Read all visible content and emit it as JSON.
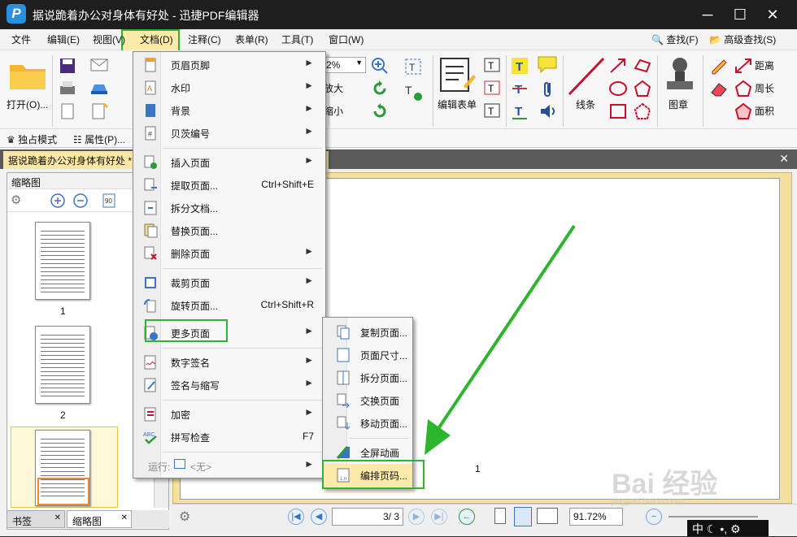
{
  "window": {
    "title": "据说跪着办公对身体有好处 - 迅捷PDF编辑器",
    "logo": "P"
  },
  "menus": [
    "文件",
    "编辑(E)",
    "视图(V)",
    "文档(D)",
    "注释(C)",
    "表单(R)",
    "工具(T)",
    "窗口(W)"
  ],
  "menu_right": {
    "find": "查找(F)",
    "adv_find": "高级查找(S)"
  },
  "ribbon": {
    "open": "打开(O)...",
    "zoom": "2%",
    "zoom_in_label": "放大",
    "zoom_out_label": "缩小",
    "edit_form": "编辑表单",
    "line": "线条",
    "stamp": "图章",
    "distance": "距离",
    "perimeter": "周长",
    "area": "面积",
    "exclusive": "独占模式",
    "properties": "属性(P)..."
  },
  "doc_tab": "据说跪着办公对身体有好处 *",
  "left_panel": {
    "header": "缩略图",
    "thumbs": [
      "1",
      "2"
    ],
    "tabs": [
      "书签",
      "缩略图"
    ]
  },
  "doc_menu": {
    "items": [
      {
        "label": "页眉页脚",
        "arrow": "►"
      },
      {
        "label": "水印",
        "arrow": "►"
      },
      {
        "label": "背景",
        "arrow": "►"
      },
      {
        "label": "贝茨编号",
        "arrow": "►"
      },
      {
        "label": "插入页面",
        "arrow": "►"
      },
      {
        "label": "提取页面...",
        "shortcut": "Ctrl+Shift+E"
      },
      {
        "label": "拆分文档..."
      },
      {
        "label": "替换页面..."
      },
      {
        "label": "删除页面",
        "arrow": "►"
      },
      {
        "label": "裁剪页面",
        "arrow": "►"
      },
      {
        "label": "旋转页面...",
        "shortcut": "Ctrl+Shift+R"
      },
      {
        "label": "更多页面",
        "arrow": "►"
      },
      {
        "label": "数字签名",
        "arrow": "►"
      },
      {
        "label": "签名与缩写",
        "arrow": "►"
      },
      {
        "label": "加密",
        "arrow": "►"
      },
      {
        "label": "拼写检查",
        "shortcut": "F7"
      },
      {
        "label": "运行:",
        "run_value": "<无>",
        "arrow": "►"
      }
    ]
  },
  "more_pages_menu": {
    "items": [
      "复制页面...",
      "页面尺寸...",
      "拆分页面...",
      "交换页面",
      "移动页面...",
      "全屏动画",
      "编排页码..."
    ]
  },
  "page_label": "1",
  "status": {
    "page": "3",
    "total": "/ 3",
    "zoom": "91.72%"
  },
  "ime": {
    "lang": "中"
  },
  "watermark": "Bai 经验",
  "watermark_sub": "jingyan.baidu.com",
  "colors": {
    "highlight": "#2db52d",
    "menu_bg": "#fde9a8"
  }
}
